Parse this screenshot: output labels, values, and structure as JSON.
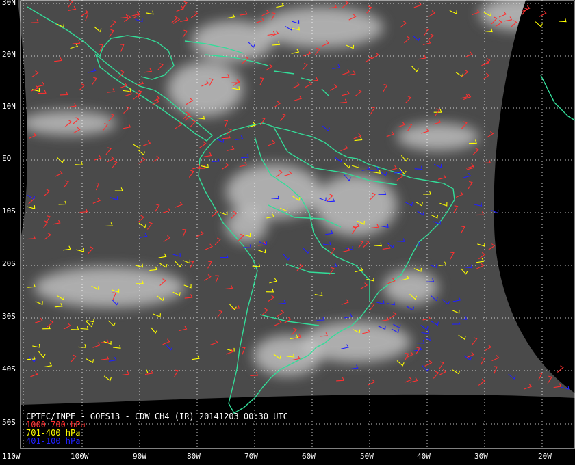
{
  "title": "CPTEC/INPE - GOES13 - CDW CH4 (IR) 20141203 00:30 UTC",
  "legend": [
    {
      "label": "1000-700 hPa",
      "color": "#ff3030"
    },
    {
      "label": "701-400 hPa",
      "color": "#ffff00"
    },
    {
      "label": "401-100 hPa",
      "color": "#2020ff"
    }
  ],
  "colors": {
    "coastline": "#33dd99",
    "grid": "#ffffff",
    "space": "#000000"
  },
  "lat_labels": [
    "30N",
    "20N",
    "10N",
    "EQ",
    "10S",
    "20S",
    "30S",
    "40S",
    "50S"
  ],
  "lon_labels": [
    "110W",
    "100W",
    "90W",
    "80W",
    "70W",
    "60W",
    "50W",
    "40W",
    "30W",
    "20W"
  ]
}
